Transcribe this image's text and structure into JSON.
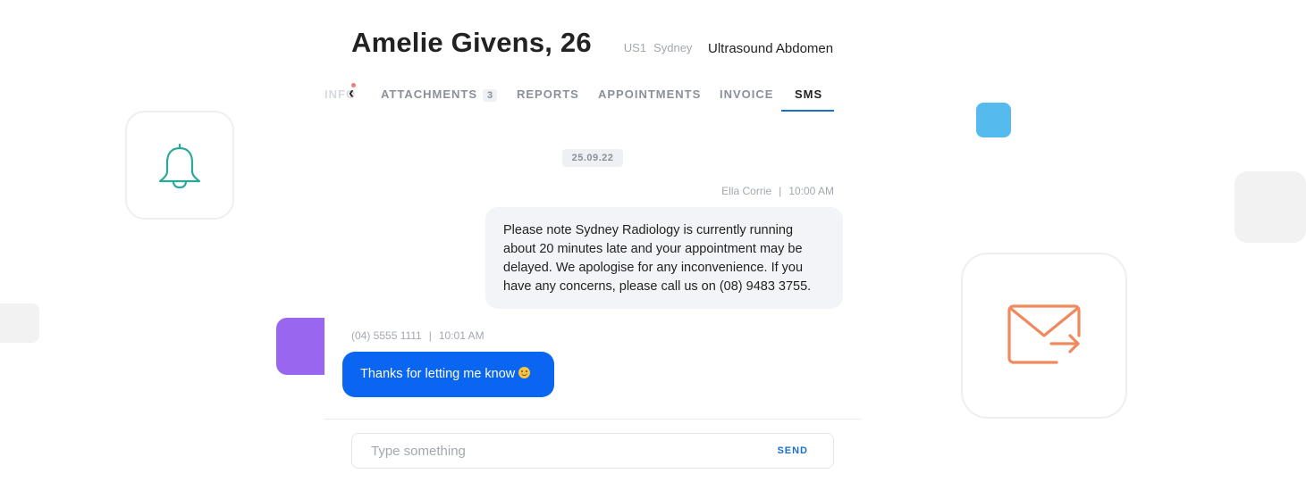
{
  "patient": {
    "name": "Amelie Givens, 26",
    "room": "US1",
    "site": "Sydney",
    "exam": "Ultrasound Abdomen"
  },
  "tabs": {
    "info": "INFO",
    "attachments": "ATTACHMENTS",
    "attachments_count": "3",
    "reports": "REPORTS",
    "appointments": "APPOINTMENTS",
    "invoice": "INVOICE",
    "sms": "SMS",
    "active": "SMS"
  },
  "thread": {
    "date": "25.09.22",
    "outgoing": {
      "sender": "Ella Corrie",
      "time": "10:00 AM",
      "text": "Please note Sydney Radiology is currently running about 20 minutes late and your appointment may be delayed. We apologise for any inconvenience. If you have any concerns, please call us on (08) 9483 3755."
    },
    "incoming": {
      "sender": "(04) 5555 1111",
      "time": "10:01 AM",
      "text": "Thanks for letting me know"
    }
  },
  "composer": {
    "placeholder": "Type something",
    "send_label": "SEND"
  },
  "icons": {
    "bell": "bell-icon",
    "mail": "mail-send-icon",
    "chevron": "chevron-left-icon"
  },
  "colors": {
    "accent": "#1a6fc9",
    "incoming_bubble": "#0a66f0",
    "bell": "#2aa89a",
    "mail": "#f08a5d",
    "purple_tile": "#9966f0",
    "blue_tile": "#55bbee"
  }
}
